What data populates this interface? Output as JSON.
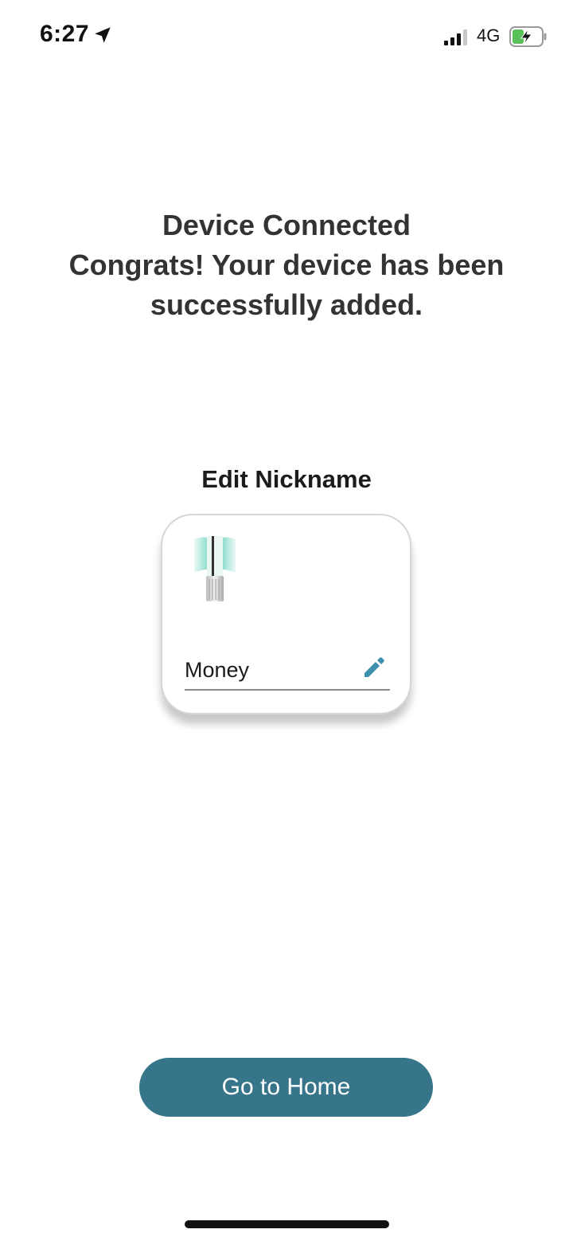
{
  "status_bar": {
    "time": "6:27",
    "network": "4G",
    "icons": [
      "location-arrow-icon",
      "cellular-signal-icon",
      "battery-charging-icon"
    ],
    "battery_color": "#5ac05a"
  },
  "heading": {
    "line1": "Device Connected",
    "line2": "Congrats! Your device has been",
    "line3": "successfully added."
  },
  "nickname_section": {
    "title": "Edit Nickname",
    "device_nickname": "Money",
    "device_icon": "air-purifier-tower-icon",
    "edit_icon": "pencil-icon"
  },
  "actions": {
    "go_home_label": "Go to Home"
  },
  "colors": {
    "primary_button": "#37768a",
    "edit_icon": "#3d8fb0",
    "heading_text": "#333333",
    "device_glow": "#7fd8c6"
  }
}
